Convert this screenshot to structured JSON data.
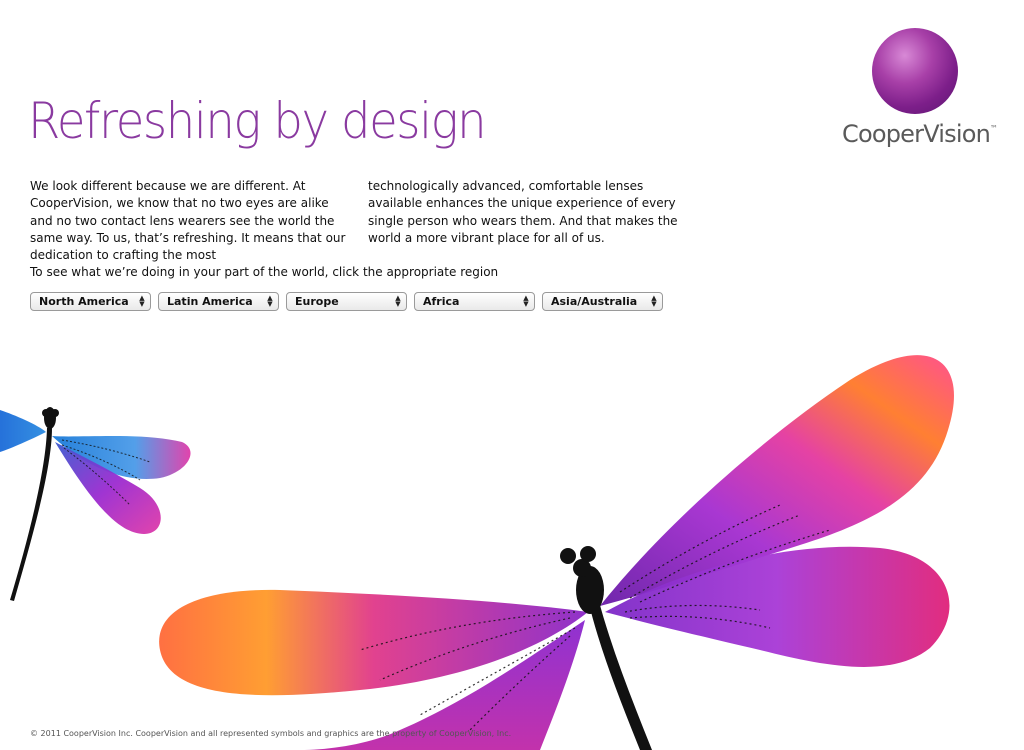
{
  "header": {
    "headline": "Refreshing by design"
  },
  "logo": {
    "name": "CooperVision",
    "trademark": "™"
  },
  "intro": {
    "column1": "We look different because we are different. At CooperVision, we know that no two eyes are alike and no two contact lens wearers see the world the same way. To us, that’s refreshing. It means that our dedication to crafting the most",
    "column2": "technologically advanced, comfortable lenses available enhances the unique experience of every single person who wears them. And that makes the world a more vibrant place for all of us."
  },
  "region_prompt": "To see what we’re doing in your part of the world, click the appropriate region",
  "regions": [
    {
      "label": "North America"
    },
    {
      "label": "Latin America"
    },
    {
      "label": "Europe"
    },
    {
      "label": "Africa"
    },
    {
      "label": "Asia/Australia"
    }
  ],
  "footer": {
    "copyright": "© 2011 CooperVision Inc. CooperVision and all represented symbols and graphics are the property of CooperVision, Inc."
  },
  "colors": {
    "headline": "#8a3aa0",
    "logo_ball": "#8e2f97",
    "logo_text": "#5a5a5a"
  },
  "icons": {
    "logo_mark": "purple-watercolor-circle",
    "select_arrow": "up-down-arrows",
    "illustration": "watercolor-dragonflies"
  }
}
